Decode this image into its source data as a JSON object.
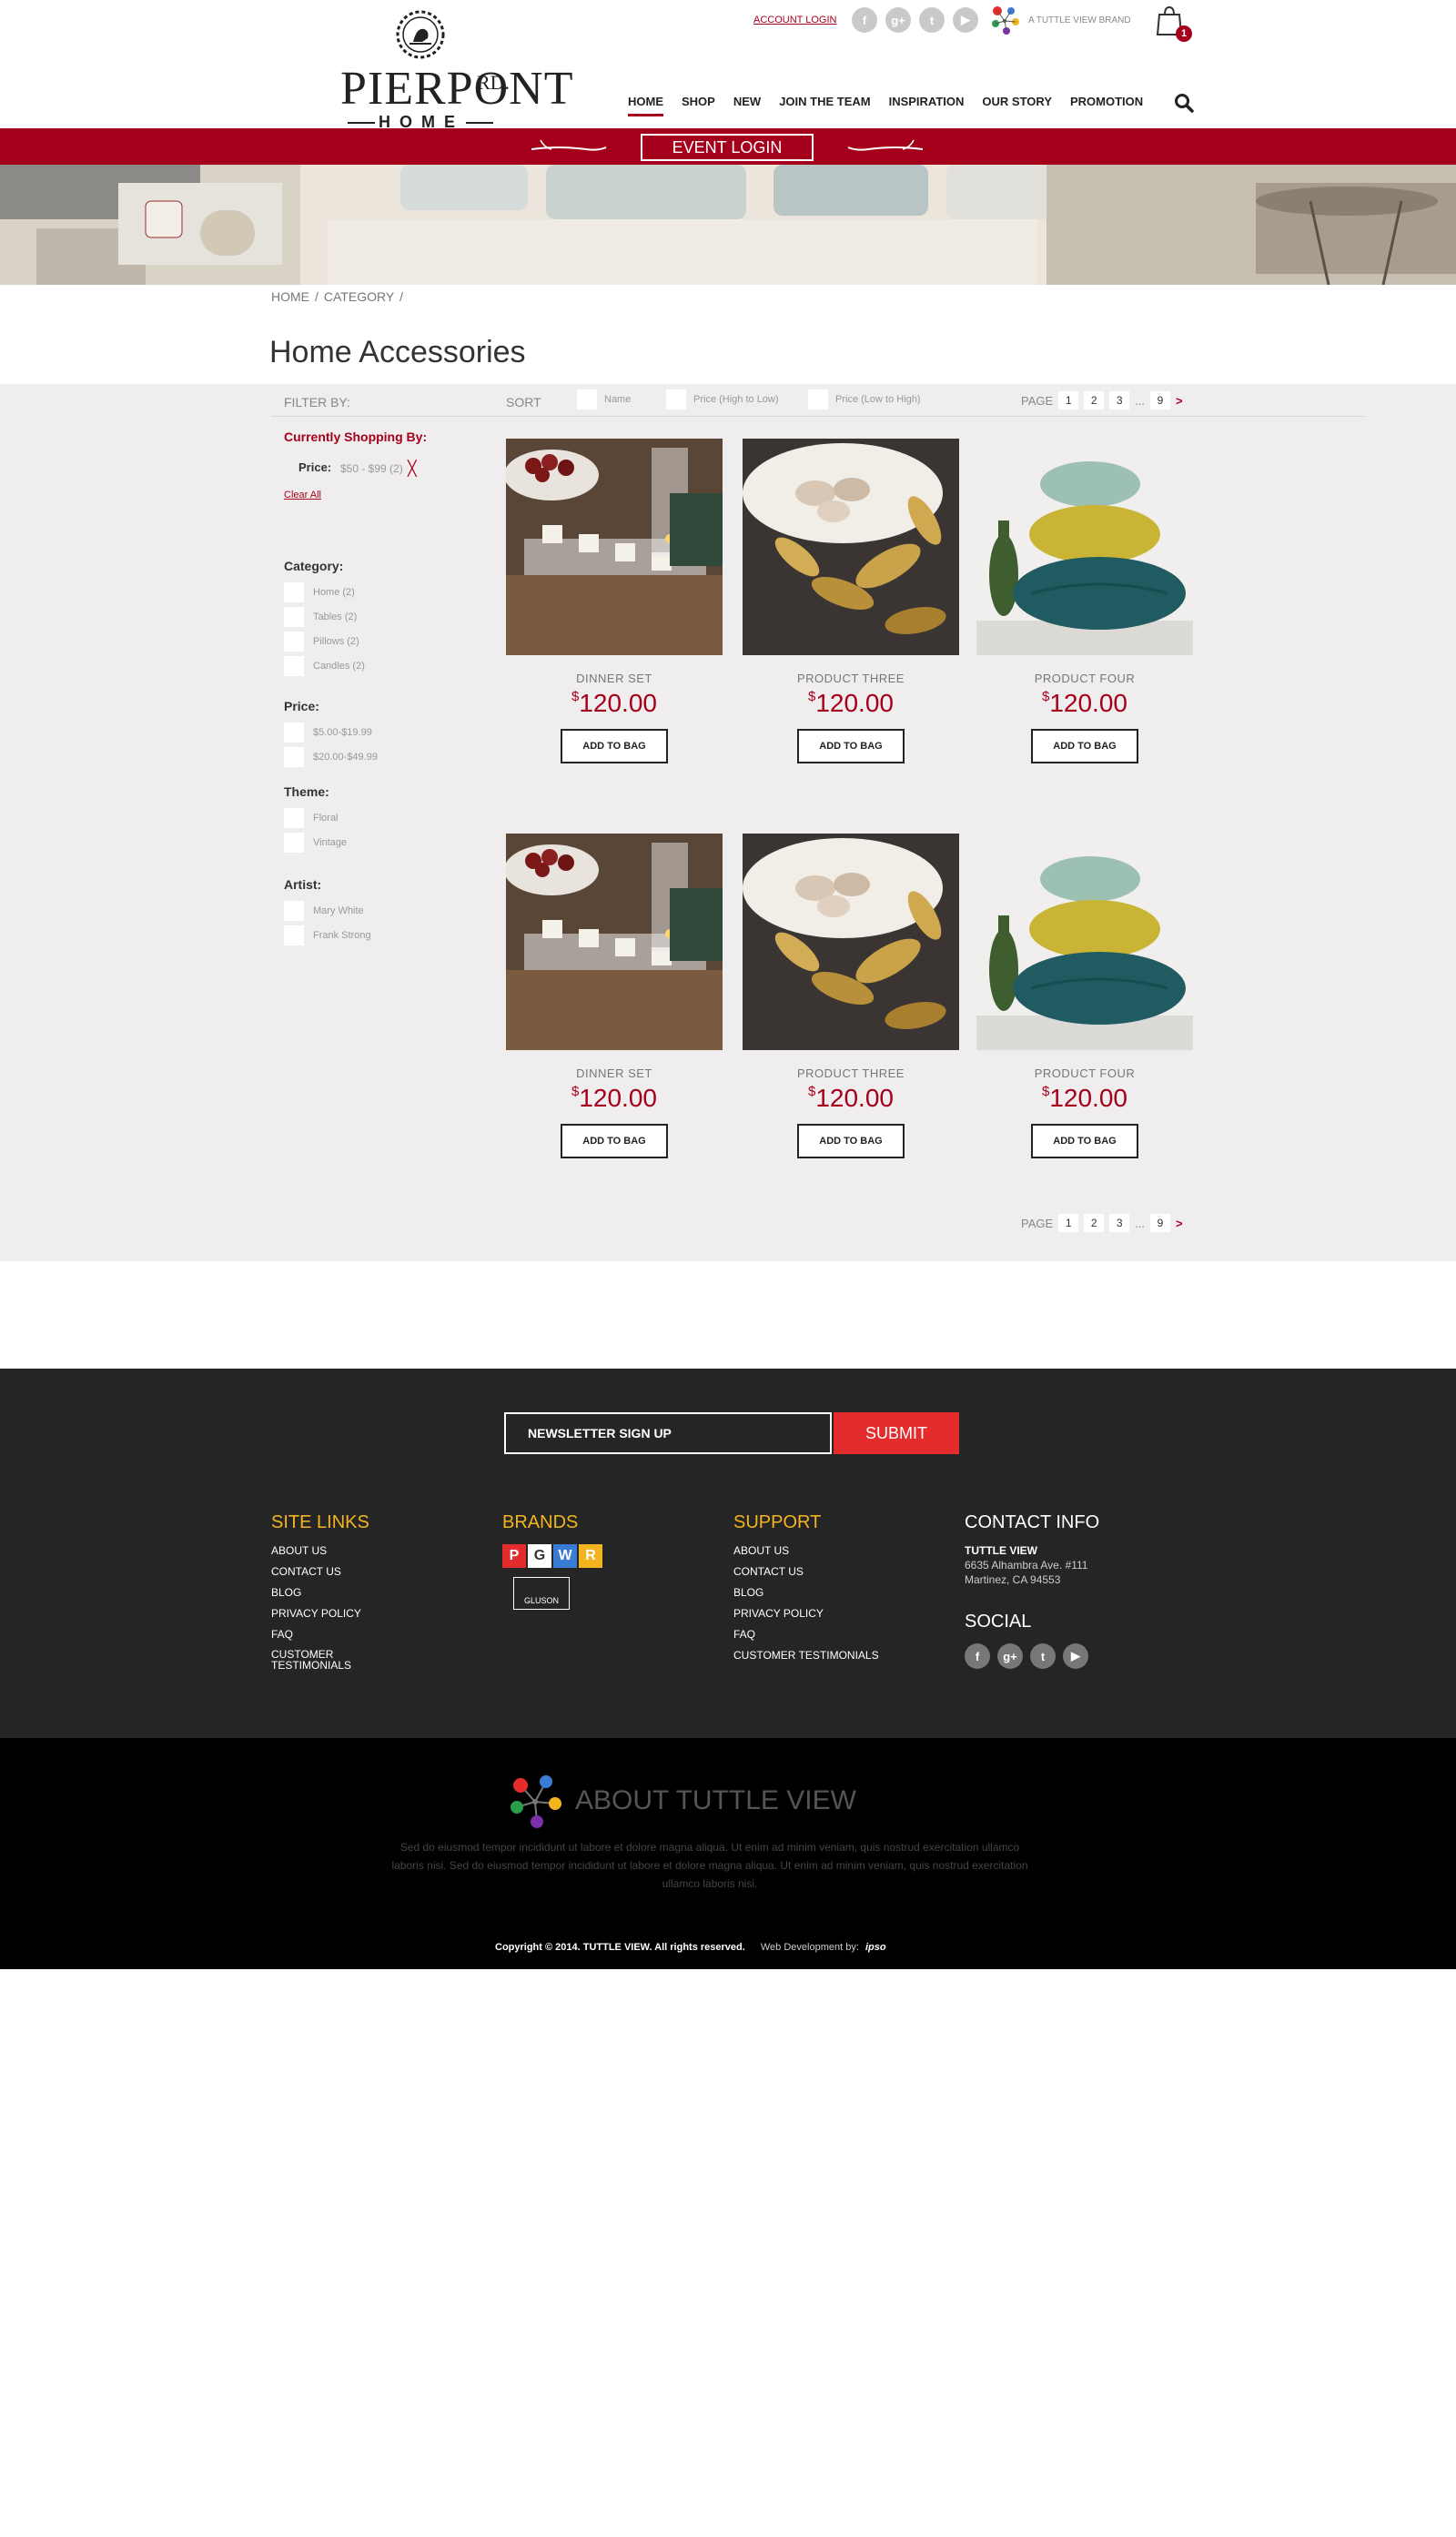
{
  "brand": {
    "logo_word": "PIERPONT",
    "logo_rd": "RD.",
    "logo_home": "HOME",
    "tagline": "A TUTTLE VIEW BRAND"
  },
  "header": {
    "account_login": "ACCOUNT LOGIN",
    "social": [
      {
        "icon": "facebook-icon",
        "glyph": "f"
      },
      {
        "icon": "google-plus-icon",
        "glyph": "g+"
      },
      {
        "icon": "twitter-icon",
        "glyph": "t"
      },
      {
        "icon": "youtube-icon",
        "glyph": "▶"
      }
    ],
    "cart_count": "1"
  },
  "nav": [
    {
      "label": "HOME",
      "active": true
    },
    {
      "label": "SHOP"
    },
    {
      "label": "NEW"
    },
    {
      "label": "JOIN THE TEAM"
    },
    {
      "label": "INSPIRATION"
    },
    {
      "label": "OUR STORY"
    },
    {
      "label": "PROMOTION"
    }
  ],
  "event_login": "EVENT LOGIN",
  "breadcrumb": [
    "HOME",
    "/",
    "CATEGORY",
    "/"
  ],
  "page_title": "Home Accessories",
  "toolbar": {
    "filter_by": "FILTER BY:",
    "sort": "SORT",
    "sort_options": [
      "Name",
      "Price (High to Low)",
      "Price (Low to High)"
    ],
    "page_label": "PAGE",
    "pages": [
      "1",
      "2",
      "3",
      "...",
      "9"
    ],
    "next": ">"
  },
  "filters": {
    "currently": "Currently Shopping By:",
    "price_label": "Price:",
    "price_value": "$50 - $99 (2)",
    "remove": "╳",
    "clear_all": "Clear All",
    "groups": [
      {
        "title": "Category:",
        "items": [
          "Home (2)",
          "Tables (2)",
          "Pillows (2)",
          "Candles (2)"
        ]
      },
      {
        "title": "Price:",
        "items": [
          "$5.00-$19.99",
          "$20.00-$49.99"
        ]
      },
      {
        "title": "Theme:",
        "items": [
          "Floral",
          "Vintage"
        ]
      },
      {
        "title": "Artist:",
        "items": [
          "Mary White",
          "Frank Strong"
        ]
      }
    ]
  },
  "products": [
    {
      "name": "DINNER SET",
      "currency": "$",
      "price": "120.00",
      "button": "ADD TO BAG",
      "kind": "candles"
    },
    {
      "name": "PRODUCT THREE",
      "currency": "$",
      "price": "120.00",
      "button": "ADD TO BAG",
      "kind": "leaves"
    },
    {
      "name": "PRODUCT FOUR",
      "currency": "$",
      "price": "120.00",
      "button": "ADD TO BAG",
      "kind": "pillows"
    },
    {
      "name": "DINNER SET",
      "currency": "$",
      "price": "120.00",
      "button": "ADD TO BAG",
      "kind": "candles"
    },
    {
      "name": "PRODUCT THREE",
      "currency": "$",
      "price": "120.00",
      "button": "ADD TO BAG",
      "kind": "leaves"
    },
    {
      "name": "PRODUCT FOUR",
      "currency": "$",
      "price": "120.00",
      "button": "ADD TO BAG",
      "kind": "pillows"
    }
  ],
  "footer": {
    "newsletter_placeholder": "NEWSLETTER SIGN UP",
    "submit": "SUBMIT",
    "site_links": {
      "title": "SITE LINKS",
      "items": [
        "ABOUT US",
        "CONTACT US",
        "BLOG",
        "PRIVACY POLICY",
        "FAQ",
        "CUSTOMER TESTIMONIALS"
      ]
    },
    "brands": {
      "title": "BRANDS",
      "tiles": [
        "P",
        "G",
        "W",
        "R"
      ],
      "second": "GLUSON"
    },
    "support": {
      "title": "SUPPORT",
      "items": [
        "ABOUT US",
        "CONTACT US",
        "BLOG",
        "PRIVACY POLICY",
        "FAQ",
        "CUSTOMER TESTIMONIALS"
      ]
    },
    "contact": {
      "title": "CONTACT INFO",
      "company": "TUTTLE VIEW",
      "address1": "6635 Alhambra Ave. #111",
      "address2": "Martinez, CA 94553"
    },
    "social_title": "SOCIAL"
  },
  "about": {
    "title": "ABOUT TUTTLE VIEW",
    "text": "Sed do eiusmod tempor incididunt ut labore et dolore magna aliqua. Ut enim ad minim veniam, quis nostrud exercitation ullamco laboris nisi. Sed do eiusmod tempor incididunt ut labore et dolore magna aliqua. Ut enim ad minim veniam, quis nostrud exercitation ullamco laboris nisi.",
    "copyright": "Copyright © 2014. TUTTLE VIEW. All rights reserved.",
    "webdev": "Web Development by:",
    "dev_logo": "ipso"
  },
  "colors": {
    "accent": "#a5001b",
    "submit": "#e52c2c",
    "footer_bg": "#262525",
    "gold": "#f2b51f"
  }
}
